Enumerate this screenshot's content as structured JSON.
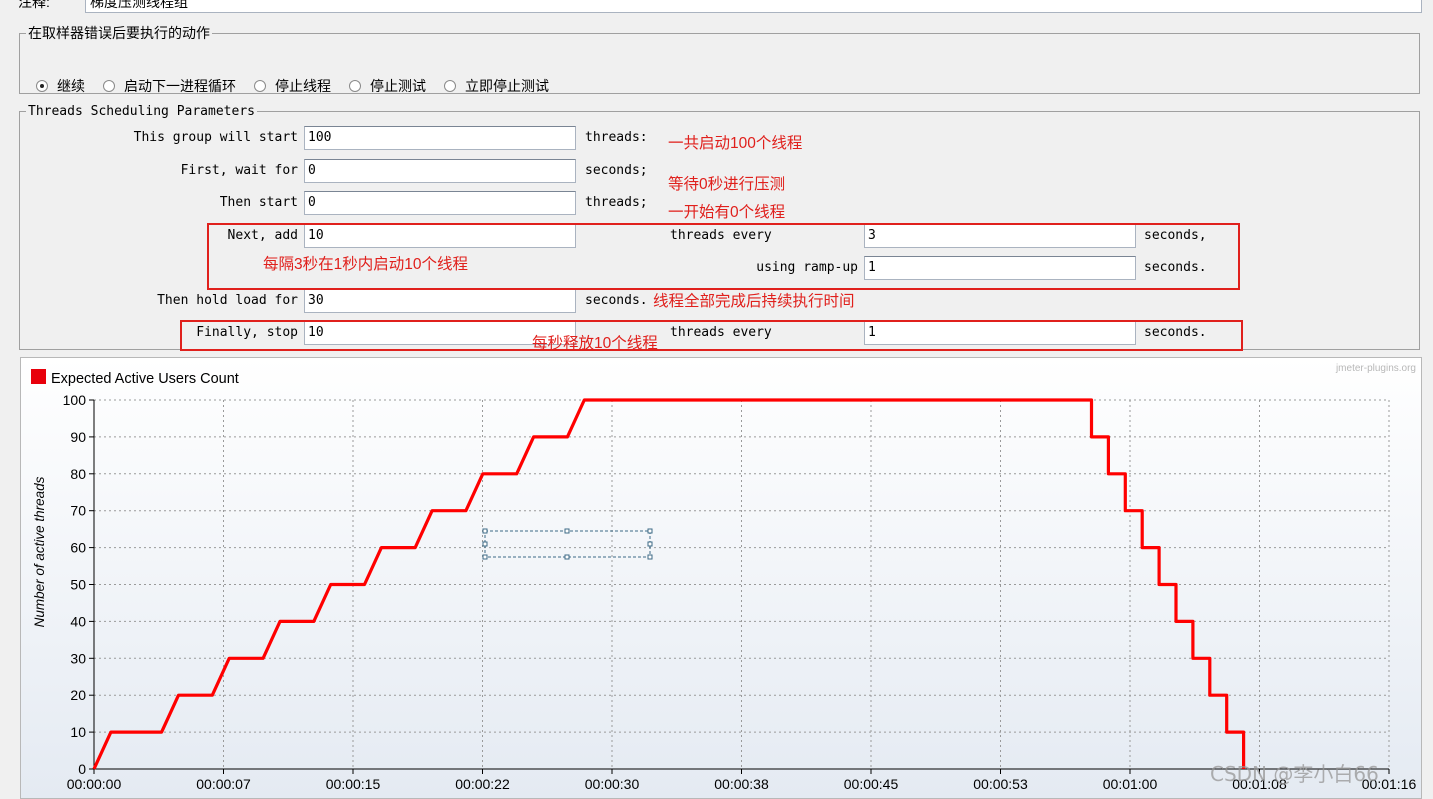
{
  "comment": {
    "label": "注释:",
    "value": "梯度压测线程组"
  },
  "error_action": {
    "title": "在取样器错误后要执行的动作",
    "options": [
      {
        "label": "继续",
        "selected": true
      },
      {
        "label": "启动下一进程循环",
        "selected": false
      },
      {
        "label": "停止线程",
        "selected": false
      },
      {
        "label": "停止测试",
        "selected": false
      },
      {
        "label": "立即停止测试",
        "selected": false
      }
    ]
  },
  "scheduling": {
    "title": "Threads Scheduling Parameters",
    "start_label": "This group will start",
    "start_value": "100",
    "start_unit": "threads:",
    "wait_label": "First, wait for",
    "wait_value": "0",
    "wait_unit": "seconds;",
    "then_start_label": "Then start",
    "then_start_value": "0",
    "then_start_unit": "threads;",
    "next_add_label": "Next, add",
    "next_add_value": "10",
    "next_every_label": "threads every",
    "next_every_value": "3",
    "next_every_unit": "seconds,",
    "rampup_label": "using ramp-up",
    "rampup_value": "1",
    "rampup_unit": "seconds.",
    "hold_label": "Then hold load for",
    "hold_value": "30",
    "hold_unit": "seconds.",
    "stop_label": "Finally, stop",
    "stop_value": "10",
    "stop_every_label": "threads every",
    "stop_every_value": "1",
    "stop_every_unit": "seconds."
  },
  "annotations": {
    "total": "一共启动100个线程",
    "wait": "等待0秒进行压测",
    "initial": "一开始有0个线程",
    "step": "每隔3秒在1秒内启动10个线程",
    "hold": "线程全部完成后持续执行时间",
    "stop": "每秒释放10个线程"
  },
  "colors": {
    "accent": "#e0201c",
    "series": "#ff0000"
  },
  "chart_data": {
    "type": "line",
    "legend": "Expected Active Users Count",
    "brand": "jmeter-plugins.org",
    "ylabel": "Number of active threads",
    "xlabel": "",
    "ylim": [
      0,
      100
    ],
    "xlim_seconds": [
      0,
      76.6
    ],
    "yticks": [
      0,
      10,
      20,
      30,
      40,
      50,
      60,
      70,
      80,
      90,
      100
    ],
    "xtick_labels": [
      "00:00:00",
      "00:00:07",
      "00:00:15",
      "00:00:22",
      "00:00:30",
      "00:00:38",
      "00:00:45",
      "00:00:53",
      "00:01:00",
      "00:01:08",
      "00:01:16"
    ],
    "grid": true,
    "legend_position": "top-left",
    "series": [
      {
        "name": "Expected Active Users Count",
        "points": [
          [
            0,
            0
          ],
          [
            1,
            10
          ],
          [
            4,
            10
          ],
          [
            5,
            20
          ],
          [
            7,
            20
          ],
          [
            8,
            30
          ],
          [
            10,
            30
          ],
          [
            11,
            40
          ],
          [
            13,
            40
          ],
          [
            14,
            50
          ],
          [
            16,
            50
          ],
          [
            17,
            60
          ],
          [
            19,
            60
          ],
          [
            20,
            70
          ],
          [
            22,
            70
          ],
          [
            23,
            80
          ],
          [
            25,
            80
          ],
          [
            26,
            90
          ],
          [
            28,
            90
          ],
          [
            29,
            100
          ],
          [
            59,
            100
          ],
          [
            59,
            90
          ],
          [
            60,
            90
          ],
          [
            60,
            80
          ],
          [
            61,
            80
          ],
          [
            61,
            70
          ],
          [
            62,
            70
          ],
          [
            62,
            60
          ],
          [
            63,
            60
          ],
          [
            63,
            50
          ],
          [
            64,
            50
          ],
          [
            64,
            40
          ],
          [
            65,
            40
          ],
          [
            65,
            30
          ],
          [
            66,
            30
          ],
          [
            66,
            20
          ],
          [
            67,
            20
          ],
          [
            67,
            10
          ],
          [
            68,
            10
          ],
          [
            68,
            0
          ]
        ]
      }
    ]
  },
  "watermark": "CSDN @李小白66"
}
